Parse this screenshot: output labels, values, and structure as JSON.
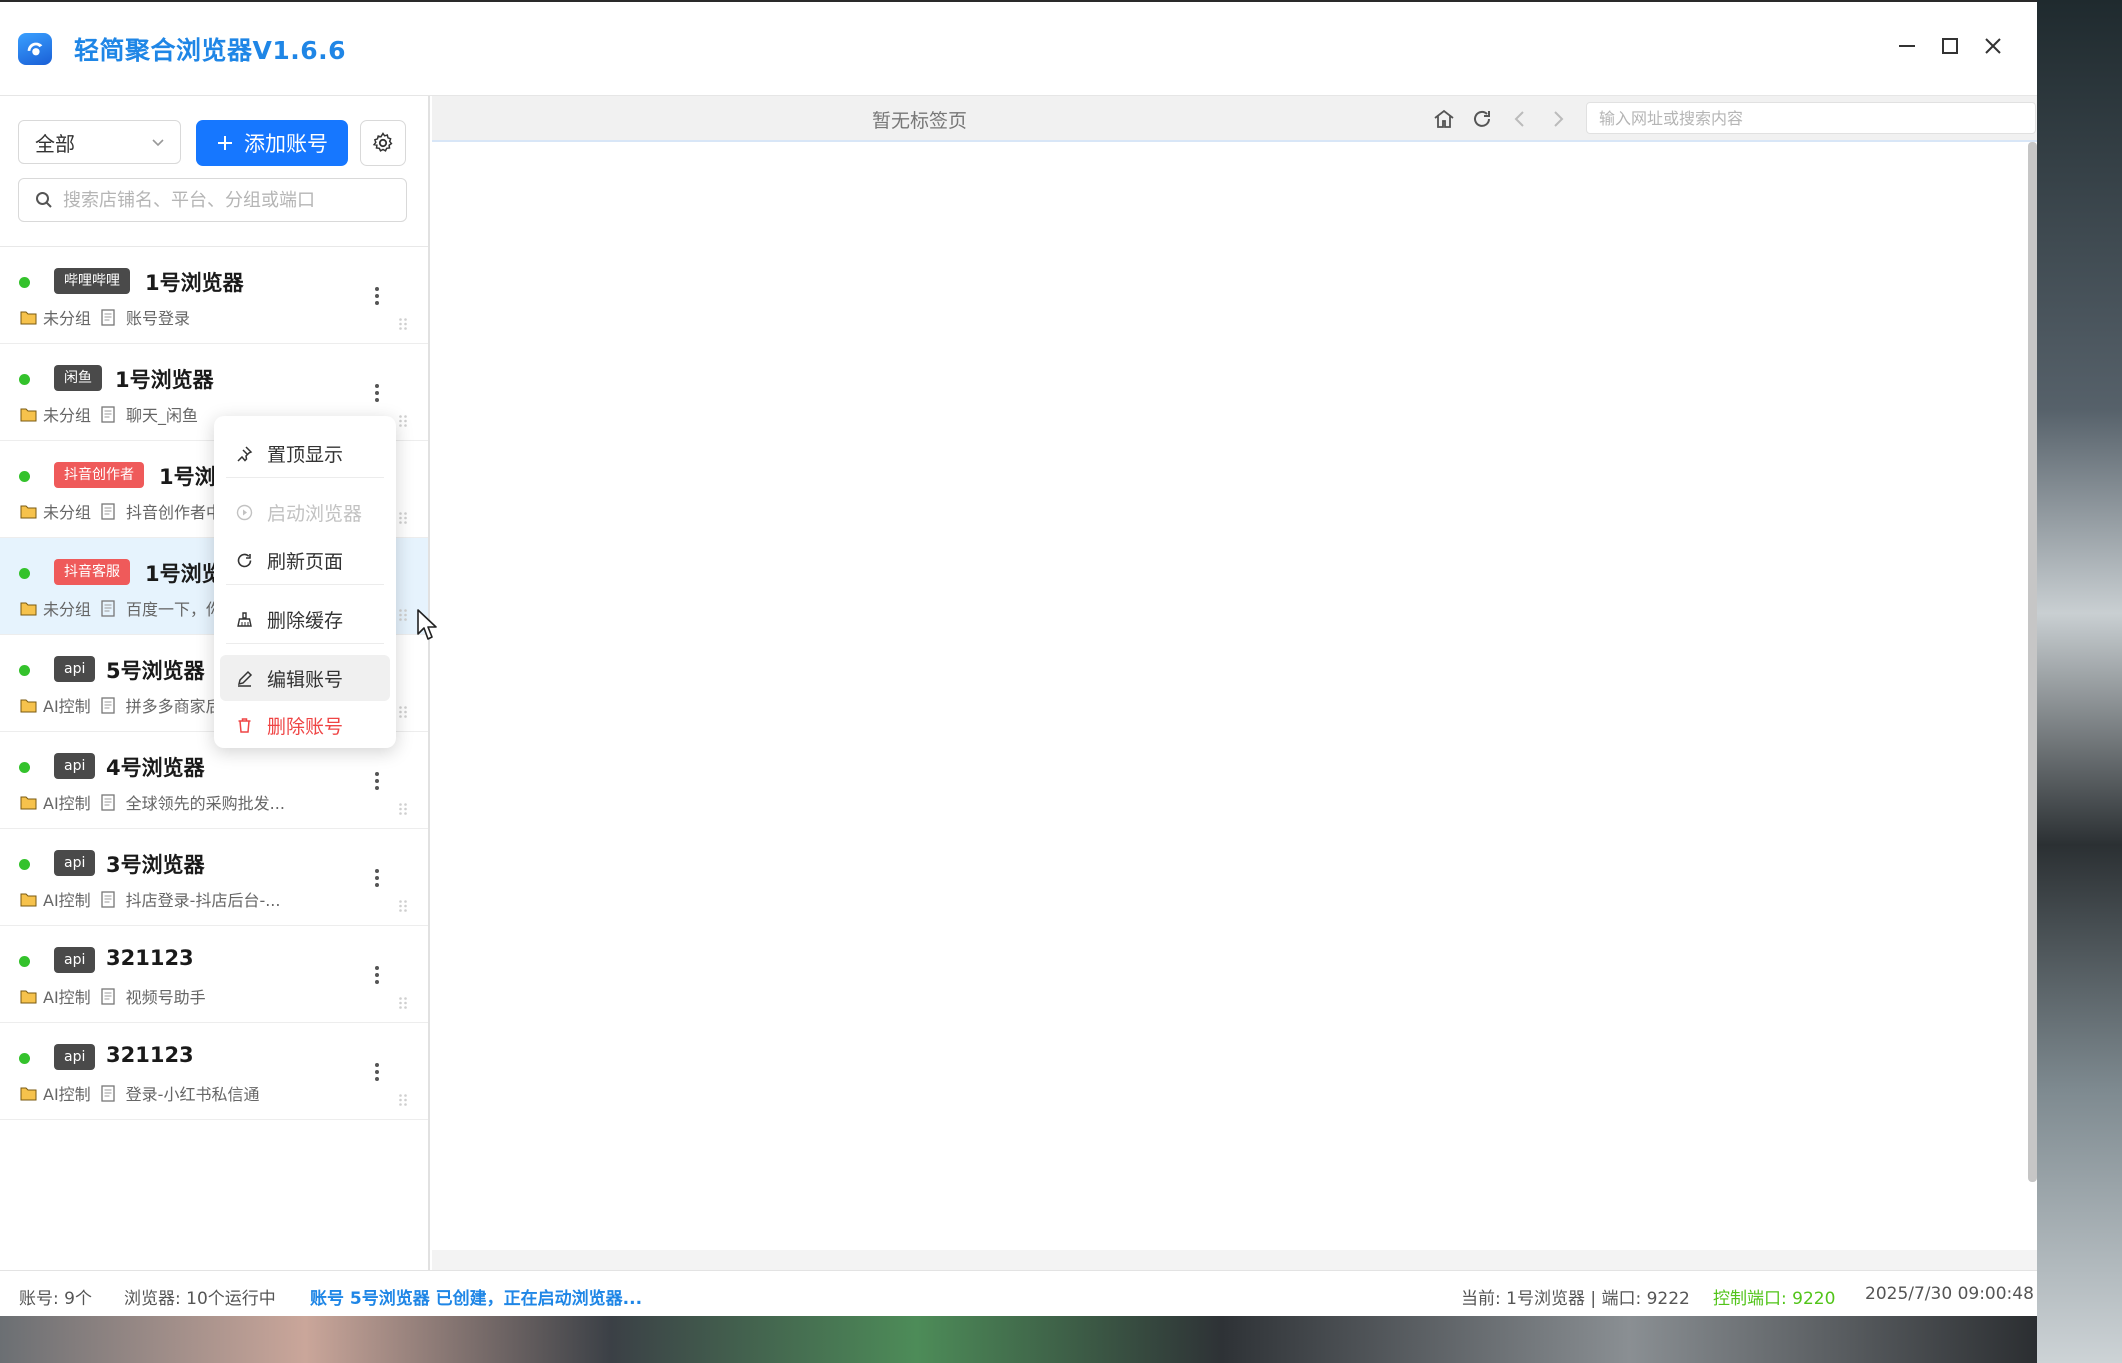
{
  "app": {
    "title": "轻简聚合浏览器V1.6.6"
  },
  "colors": {
    "accent": "#1677ff",
    "title": "#1f86e6",
    "online": "#34c22c",
    "danger": "#ef4545",
    "ok": "#52c41a"
  },
  "toolbar": {
    "group_selected": "全部",
    "add_account_label": "添加账号",
    "search_placeholder": "搜索店铺名、平台、分组或端口"
  },
  "accounts": [
    {
      "tag": "哔哩哔哩",
      "tag_style": "dark",
      "name": "1号浏览器",
      "group": "未分组",
      "page": "账号登录",
      "status": "online"
    },
    {
      "tag": "闲鱼",
      "tag_style": "dark",
      "name": "1号浏览器",
      "group": "未分组",
      "page": "聊天_闲鱼",
      "status": "online"
    },
    {
      "tag": "抖音创作者",
      "tag_style": "red",
      "name": "1号浏",
      "group": "未分组",
      "page": "抖音创作者中",
      "status": "online"
    },
    {
      "tag": "抖音客服",
      "tag_style": "red",
      "name": "1号浏览",
      "group": "未分组",
      "page": "百度一下，你",
      "status": "online"
    },
    {
      "tag": "api",
      "tag_style": "dark",
      "name": "5号浏览器",
      "group": "AI控制",
      "page": "拼多多商家后",
      "status": "online"
    },
    {
      "tag": "api",
      "tag_style": "dark",
      "name": "4号浏览器",
      "group": "AI控制",
      "page": "全球领先的采购批发...",
      "status": "online"
    },
    {
      "tag": "api",
      "tag_style": "dark",
      "name": "3号浏览器",
      "group": "AI控制",
      "page": "抖店登录-抖店后台-...",
      "status": "online"
    },
    {
      "tag": "api",
      "tag_style": "dark",
      "name": "321123",
      "group": "AI控制",
      "page": "视频号助手",
      "status": "online"
    },
    {
      "tag": "api",
      "tag_style": "dark",
      "name": "321123",
      "group": "AI控制",
      "page": "登录-小红书私信通",
      "status": "online"
    }
  ],
  "context_menu": {
    "items": [
      {
        "label": "置顶显示",
        "icon": "pin-icon"
      },
      {
        "label": "启动浏览器",
        "icon": "play-icon",
        "disabled": true
      },
      {
        "label": "刷新页面",
        "icon": "refresh-icon"
      },
      {
        "label": "删除缓存",
        "icon": "broom-icon"
      },
      {
        "label": "编辑账号",
        "icon": "edit-icon",
        "hover": true
      },
      {
        "label": "删除账号",
        "icon": "trash-icon",
        "danger": true
      }
    ]
  },
  "browser": {
    "no_tabs": "暂无标签页",
    "url_placeholder": "输入网址或搜索内容"
  },
  "statusbar": {
    "accounts": "账号: 9个",
    "browsers": "浏览器: 10个运行中",
    "message": "账号 5号浏览器 已创建，正在启动浏览器...",
    "current": "当前: 1号浏览器 | 端口: 9222",
    "control_port": "控制端口: 9220",
    "datetime": "2025/7/30 09:00:48"
  }
}
